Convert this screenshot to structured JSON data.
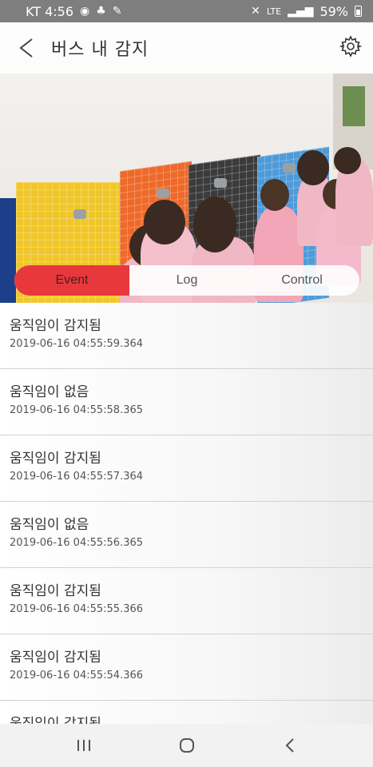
{
  "status_bar": {
    "carrier_time": "KT 4:56",
    "network": "LTE",
    "battery": "59%"
  },
  "header": {
    "title": "버스 내 감지"
  },
  "tabs": [
    {
      "label": "Event",
      "active": true
    },
    {
      "label": "Log",
      "active": false
    },
    {
      "label": "Control",
      "active": false
    }
  ],
  "events": [
    {
      "title": "움직임이 감지됨",
      "time": "2019-06-16 04:55:59.364"
    },
    {
      "title": "움직임이 없음",
      "time": "2019-06-16 04:55:58.365"
    },
    {
      "title": "움직임이 감지됨",
      "time": "2019-06-16 04:55:57.364"
    },
    {
      "title": "움직임이 없음",
      "time": "2019-06-16 04:55:56.365"
    },
    {
      "title": "움직임이 감지됨",
      "time": "2019-06-16 04:55:55.366"
    },
    {
      "title": "움직임이 감지됨",
      "time": "2019-06-16 04:55:54.366"
    },
    {
      "title": "움직임이 감지됨",
      "time": ""
    }
  ],
  "colors": {
    "accent": "#e8383e",
    "status_bar": "#7e7e7e"
  },
  "icons": {
    "back": "back-arrow-icon",
    "settings": "gear-icon",
    "nav_recent": "recent-apps-icon",
    "nav_home": "home-icon",
    "nav_back": "nav-back-icon"
  }
}
